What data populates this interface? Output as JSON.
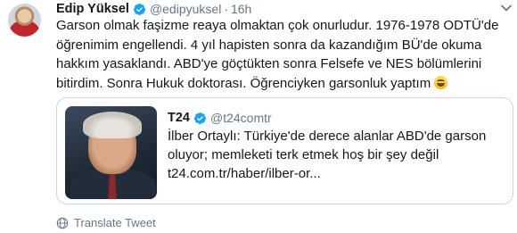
{
  "author": {
    "name": "Edip Yüksel",
    "handle": "@edipyuksel",
    "separator": "·",
    "time": "16h"
  },
  "tweet": {
    "text": "Garson olmak faşizme reaya olmaktan çok onurludur. 1976-1978 ODTÜ'de öğrenimim engellendi. 4 yıl hapisten sonra da kazandığım BÜ'de okuma hakkım yasaklandı. ABD'ye göçtükten sonra Felsefe ve NES bölümlerini bitirdim. Sonra Hukuk doktorası. Öğrenciyken garsonluk yaptım"
  },
  "quoted": {
    "name": "T24",
    "handle": "@t24comtr",
    "line1": "İlber Ortaylı: Türkiye'de derece alanlar ABD'de garson",
    "line2": "oluyor; memleketi terk etmek hoş bir şey değil",
    "link": "t24.com.tr/haber/ilber-or..."
  },
  "actions": {
    "translate_label": "Translate Tweet"
  },
  "icons": {
    "verified": "verified-badge-icon",
    "chevron": "chevron-down-icon",
    "globe": "globe-icon",
    "emoji": "grinning-face-emoji"
  },
  "colors": {
    "text": "#14171a",
    "secondary": "#657786",
    "verified": "#1da1f2",
    "border": "#ccd6dd"
  }
}
